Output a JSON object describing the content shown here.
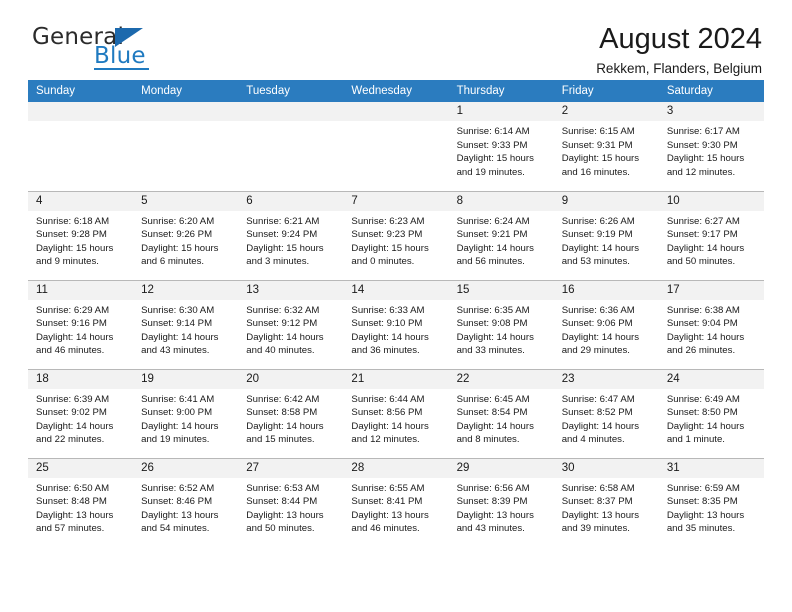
{
  "brand": {
    "name_top": "General",
    "name_bottom": "Blue",
    "triangle_color": "#1c69ad",
    "blue": "#1f7ac0"
  },
  "header": {
    "title": "August 2024",
    "subtitle": "Rekkem, Flanders, Belgium"
  },
  "theme": {
    "header_blue": "#2b7cbf",
    "daynum_strip": "#f2f2f2",
    "grid_line": "#b8b8b8"
  },
  "weekdays": [
    "Sunday",
    "Monday",
    "Tuesday",
    "Wednesday",
    "Thursday",
    "Friday",
    "Saturday"
  ],
  "weeks": [
    [
      {
        "day": "",
        "sunrise": "",
        "sunset": "",
        "daylight_1": "",
        "daylight_2": ""
      },
      {
        "day": "",
        "sunrise": "",
        "sunset": "",
        "daylight_1": "",
        "daylight_2": ""
      },
      {
        "day": "",
        "sunrise": "",
        "sunset": "",
        "daylight_1": "",
        "daylight_2": ""
      },
      {
        "day": "",
        "sunrise": "",
        "sunset": "",
        "daylight_1": "",
        "daylight_2": ""
      },
      {
        "day": "1",
        "sunrise": "Sunrise: 6:14 AM",
        "sunset": "Sunset: 9:33 PM",
        "daylight_1": "Daylight: 15 hours",
        "daylight_2": "and 19 minutes."
      },
      {
        "day": "2",
        "sunrise": "Sunrise: 6:15 AM",
        "sunset": "Sunset: 9:31 PM",
        "daylight_1": "Daylight: 15 hours",
        "daylight_2": "and 16 minutes."
      },
      {
        "day": "3",
        "sunrise": "Sunrise: 6:17 AM",
        "sunset": "Sunset: 9:30 PM",
        "daylight_1": "Daylight: 15 hours",
        "daylight_2": "and 12 minutes."
      }
    ],
    [
      {
        "day": "4",
        "sunrise": "Sunrise: 6:18 AM",
        "sunset": "Sunset: 9:28 PM",
        "daylight_1": "Daylight: 15 hours",
        "daylight_2": "and 9 minutes."
      },
      {
        "day": "5",
        "sunrise": "Sunrise: 6:20 AM",
        "sunset": "Sunset: 9:26 PM",
        "daylight_1": "Daylight: 15 hours",
        "daylight_2": "and 6 minutes."
      },
      {
        "day": "6",
        "sunrise": "Sunrise: 6:21 AM",
        "sunset": "Sunset: 9:24 PM",
        "daylight_1": "Daylight: 15 hours",
        "daylight_2": "and 3 minutes."
      },
      {
        "day": "7",
        "sunrise": "Sunrise: 6:23 AM",
        "sunset": "Sunset: 9:23 PM",
        "daylight_1": "Daylight: 15 hours",
        "daylight_2": "and 0 minutes."
      },
      {
        "day": "8",
        "sunrise": "Sunrise: 6:24 AM",
        "sunset": "Sunset: 9:21 PM",
        "daylight_1": "Daylight: 14 hours",
        "daylight_2": "and 56 minutes."
      },
      {
        "day": "9",
        "sunrise": "Sunrise: 6:26 AM",
        "sunset": "Sunset: 9:19 PM",
        "daylight_1": "Daylight: 14 hours",
        "daylight_2": "and 53 minutes."
      },
      {
        "day": "10",
        "sunrise": "Sunrise: 6:27 AM",
        "sunset": "Sunset: 9:17 PM",
        "daylight_1": "Daylight: 14 hours",
        "daylight_2": "and 50 minutes."
      }
    ],
    [
      {
        "day": "11",
        "sunrise": "Sunrise: 6:29 AM",
        "sunset": "Sunset: 9:16 PM",
        "daylight_1": "Daylight: 14 hours",
        "daylight_2": "and 46 minutes."
      },
      {
        "day": "12",
        "sunrise": "Sunrise: 6:30 AM",
        "sunset": "Sunset: 9:14 PM",
        "daylight_1": "Daylight: 14 hours",
        "daylight_2": "and 43 minutes."
      },
      {
        "day": "13",
        "sunrise": "Sunrise: 6:32 AM",
        "sunset": "Sunset: 9:12 PM",
        "daylight_1": "Daylight: 14 hours",
        "daylight_2": "and 40 minutes."
      },
      {
        "day": "14",
        "sunrise": "Sunrise: 6:33 AM",
        "sunset": "Sunset: 9:10 PM",
        "daylight_1": "Daylight: 14 hours",
        "daylight_2": "and 36 minutes."
      },
      {
        "day": "15",
        "sunrise": "Sunrise: 6:35 AM",
        "sunset": "Sunset: 9:08 PM",
        "daylight_1": "Daylight: 14 hours",
        "daylight_2": "and 33 minutes."
      },
      {
        "day": "16",
        "sunrise": "Sunrise: 6:36 AM",
        "sunset": "Sunset: 9:06 PM",
        "daylight_1": "Daylight: 14 hours",
        "daylight_2": "and 29 minutes."
      },
      {
        "day": "17",
        "sunrise": "Sunrise: 6:38 AM",
        "sunset": "Sunset: 9:04 PM",
        "daylight_1": "Daylight: 14 hours",
        "daylight_2": "and 26 minutes."
      }
    ],
    [
      {
        "day": "18",
        "sunrise": "Sunrise: 6:39 AM",
        "sunset": "Sunset: 9:02 PM",
        "daylight_1": "Daylight: 14 hours",
        "daylight_2": "and 22 minutes."
      },
      {
        "day": "19",
        "sunrise": "Sunrise: 6:41 AM",
        "sunset": "Sunset: 9:00 PM",
        "daylight_1": "Daylight: 14 hours",
        "daylight_2": "and 19 minutes."
      },
      {
        "day": "20",
        "sunrise": "Sunrise: 6:42 AM",
        "sunset": "Sunset: 8:58 PM",
        "daylight_1": "Daylight: 14 hours",
        "daylight_2": "and 15 minutes."
      },
      {
        "day": "21",
        "sunrise": "Sunrise: 6:44 AM",
        "sunset": "Sunset: 8:56 PM",
        "daylight_1": "Daylight: 14 hours",
        "daylight_2": "and 12 minutes."
      },
      {
        "day": "22",
        "sunrise": "Sunrise: 6:45 AM",
        "sunset": "Sunset: 8:54 PM",
        "daylight_1": "Daylight: 14 hours",
        "daylight_2": "and 8 minutes."
      },
      {
        "day": "23",
        "sunrise": "Sunrise: 6:47 AM",
        "sunset": "Sunset: 8:52 PM",
        "daylight_1": "Daylight: 14 hours",
        "daylight_2": "and 4 minutes."
      },
      {
        "day": "24",
        "sunrise": "Sunrise: 6:49 AM",
        "sunset": "Sunset: 8:50 PM",
        "daylight_1": "Daylight: 14 hours",
        "daylight_2": "and 1 minute."
      }
    ],
    [
      {
        "day": "25",
        "sunrise": "Sunrise: 6:50 AM",
        "sunset": "Sunset: 8:48 PM",
        "daylight_1": "Daylight: 13 hours",
        "daylight_2": "and 57 minutes."
      },
      {
        "day": "26",
        "sunrise": "Sunrise: 6:52 AM",
        "sunset": "Sunset: 8:46 PM",
        "daylight_1": "Daylight: 13 hours",
        "daylight_2": "and 54 minutes."
      },
      {
        "day": "27",
        "sunrise": "Sunrise: 6:53 AM",
        "sunset": "Sunset: 8:44 PM",
        "daylight_1": "Daylight: 13 hours",
        "daylight_2": "and 50 minutes."
      },
      {
        "day": "28",
        "sunrise": "Sunrise: 6:55 AM",
        "sunset": "Sunset: 8:41 PM",
        "daylight_1": "Daylight: 13 hours",
        "daylight_2": "and 46 minutes."
      },
      {
        "day": "29",
        "sunrise": "Sunrise: 6:56 AM",
        "sunset": "Sunset: 8:39 PM",
        "daylight_1": "Daylight: 13 hours",
        "daylight_2": "and 43 minutes."
      },
      {
        "day": "30",
        "sunrise": "Sunrise: 6:58 AM",
        "sunset": "Sunset: 8:37 PM",
        "daylight_1": "Daylight: 13 hours",
        "daylight_2": "and 39 minutes."
      },
      {
        "day": "31",
        "sunrise": "Sunrise: 6:59 AM",
        "sunset": "Sunset: 8:35 PM",
        "daylight_1": "Daylight: 13 hours",
        "daylight_2": "and 35 minutes."
      }
    ]
  ]
}
